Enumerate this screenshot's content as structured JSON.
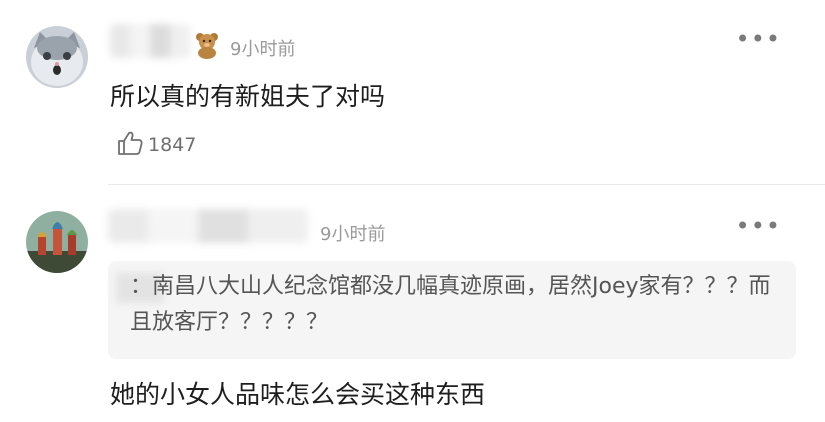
{
  "comments": [
    {
      "time": "9小时前",
      "text": "所以真的有新姐夫了对吗",
      "like_count": "1847"
    },
    {
      "time": "9小时前",
      "quote": "：南昌八大山人纪念馆都没几幅真迹原画，居然Joey家有？？？而且放客厅？？？？？",
      "text": "她的小女人品味怎么会买这种东西"
    }
  ]
}
